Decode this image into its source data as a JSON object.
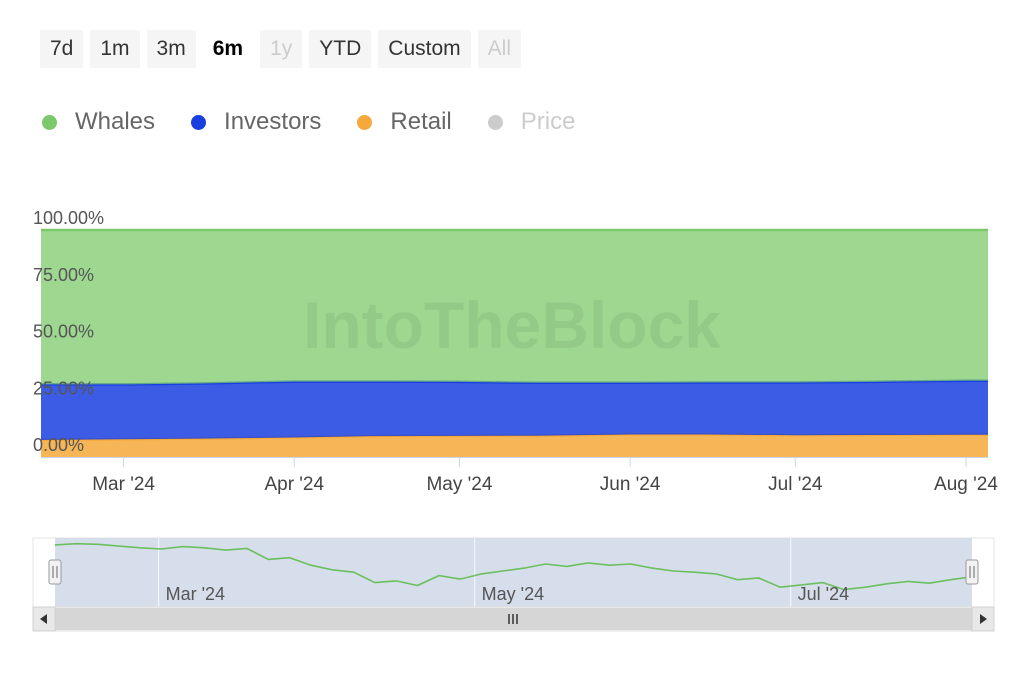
{
  "range_selector": {
    "buttons": [
      {
        "label": "7d",
        "state": "normal"
      },
      {
        "label": "1m",
        "state": "normal"
      },
      {
        "label": "3m",
        "state": "normal"
      },
      {
        "label": "6m",
        "state": "active"
      },
      {
        "label": "1y",
        "state": "disabled"
      },
      {
        "label": "YTD",
        "state": "normal"
      },
      {
        "label": "Custom",
        "state": "normal"
      },
      {
        "label": "All",
        "state": "disabled"
      }
    ]
  },
  "legend": {
    "items": [
      {
        "label": "Whales",
        "color": "#7cc96b",
        "visible": true
      },
      {
        "label": "Investors",
        "color": "#1a3fe0",
        "visible": true
      },
      {
        "label": "Retail",
        "color": "#f5a93a",
        "visible": true
      },
      {
        "label": "Price",
        "color": "#cccccc",
        "visible": false
      }
    ]
  },
  "watermark": "IntoTheBlock",
  "chart_data": {
    "type": "area",
    "stacked": "percent",
    "title": "",
    "xlabel": "",
    "ylabel": "",
    "ylim": [
      0,
      100
    ],
    "yticks": [
      "0.00%",
      "25.00%",
      "50.00%",
      "75.00%",
      "100.00%"
    ],
    "xlim": [
      "2024-02-15",
      "2024-08-05"
    ],
    "xticks": [
      {
        "label": "Mar '24",
        "date": "2024-03-01"
      },
      {
        "label": "Apr '24",
        "date": "2024-04-01"
      },
      {
        "label": "May '24",
        "date": "2024-05-01"
      },
      {
        "label": "Jun '24",
        "date": "2024-06-01"
      },
      {
        "label": "Jul '24",
        "date": "2024-07-01"
      },
      {
        "label": "Aug '24",
        "date": "2024-08-01"
      }
    ],
    "x": [
      "2024-02-15",
      "2024-03-01",
      "2024-03-15",
      "2024-04-01",
      "2024-04-15",
      "2024-05-01",
      "2024-05-15",
      "2024-06-01",
      "2024-06-15",
      "2024-07-01",
      "2024-07-15",
      "2024-08-01",
      "2024-08-05"
    ],
    "series": [
      {
        "name": "Retail",
        "color": "#f5a93a",
        "values": [
          7.5,
          7.8,
          8.1,
          8.6,
          9.2,
          9.3,
          9.4,
          9.9,
          9.9,
          9.6,
          9.7,
          9.8,
          9.8
        ]
      },
      {
        "name": "Investors",
        "color": "#1a3fe0",
        "values": [
          24.5,
          24.2,
          24.3,
          24.6,
          24.0,
          23.8,
          23.3,
          22.8,
          22.9,
          23.2,
          23.4,
          23.8,
          23.8
        ]
      },
      {
        "name": "Whales",
        "color": "#7cc96b",
        "values": [
          68.0,
          68.0,
          67.6,
          66.8,
          66.8,
          66.9,
          67.3,
          67.3,
          67.2,
          67.2,
          66.9,
          66.4,
          66.4
        ]
      }
    ]
  },
  "navigator": {
    "xticks": [
      {
        "label": "Mar '24",
        "date": "2024-03-01"
      },
      {
        "label": "May '24",
        "date": "2024-05-01"
      },
      {
        "label": "Jul '24",
        "date": "2024-07-01"
      }
    ],
    "price_series": [
      0.95,
      0.97,
      0.96,
      0.93,
      0.9,
      0.88,
      0.92,
      0.9,
      0.86,
      0.89,
      0.7,
      0.73,
      0.6,
      0.52,
      0.48,
      0.3,
      0.33,
      0.25,
      0.42,
      0.36,
      0.45,
      0.5,
      0.55,
      0.62,
      0.58,
      0.64,
      0.6,
      0.62,
      0.55,
      0.5,
      0.48,
      0.45,
      0.35,
      0.38,
      0.22,
      0.26,
      0.3,
      0.18,
      0.22,
      0.28,
      0.32,
      0.29,
      0.35,
      0.4
    ],
    "grip_icon": "three-bars"
  }
}
